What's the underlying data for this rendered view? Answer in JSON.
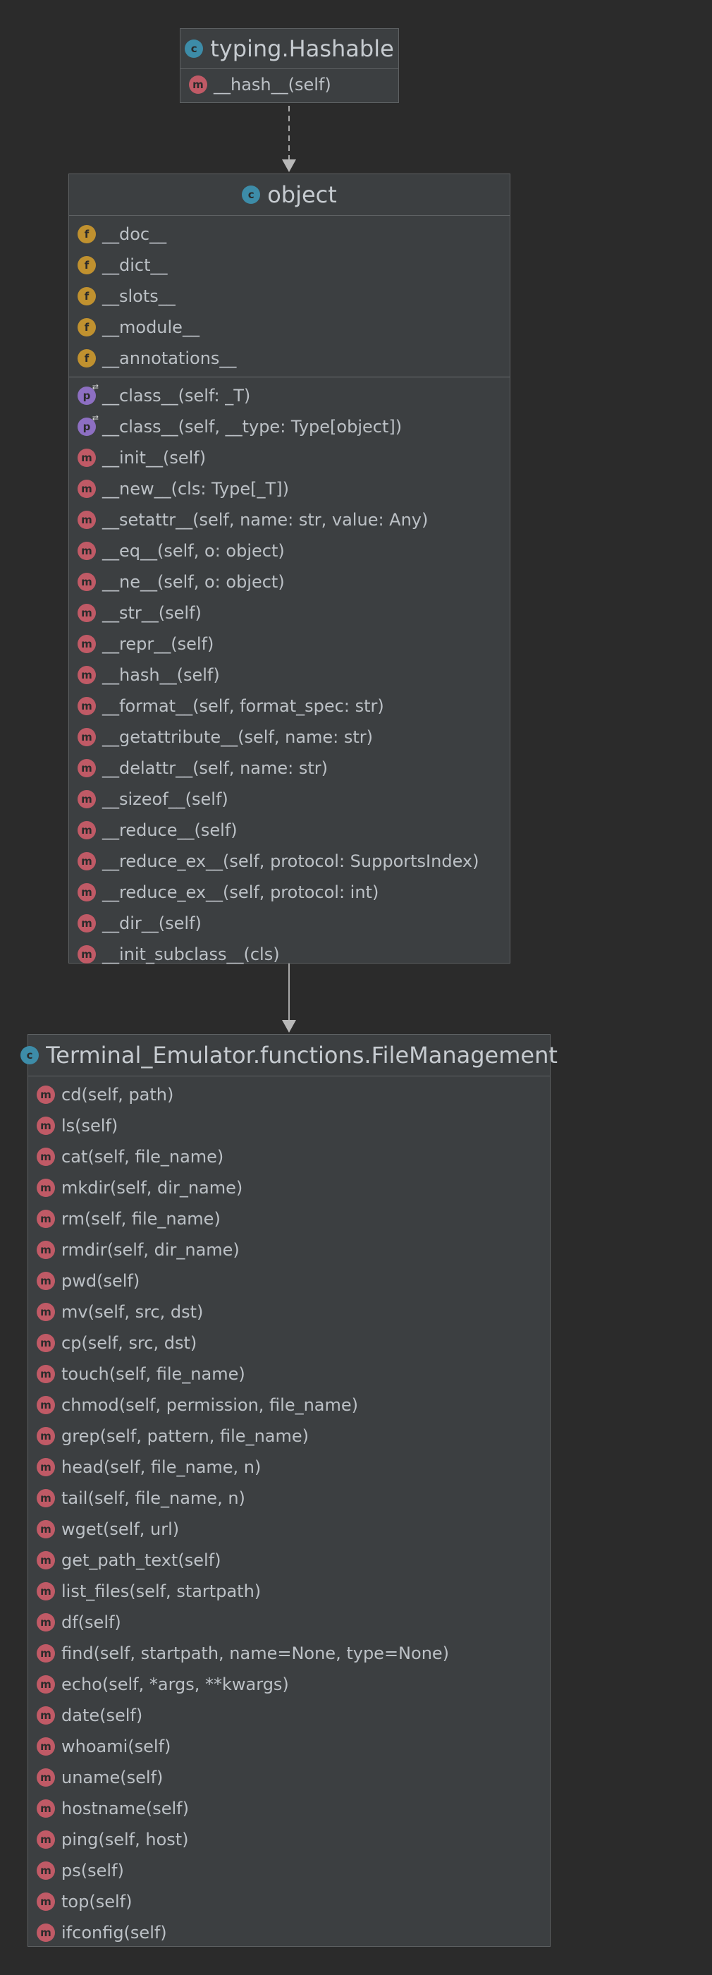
{
  "hashable": {
    "title": "typing.Hashable",
    "icon": "class-icon",
    "methods": [
      {
        "kind": "method",
        "glyph": "m",
        "text": "__hash__(self)"
      }
    ]
  },
  "object": {
    "title": "object",
    "icon": "class-icon",
    "fields": [
      {
        "kind": "field",
        "glyph": "f",
        "text": "__doc__"
      },
      {
        "kind": "field",
        "glyph": "f",
        "text": "__dict__"
      },
      {
        "kind": "field",
        "glyph": "f",
        "text": "__slots__"
      },
      {
        "kind": "field",
        "glyph": "f",
        "text": "__module__"
      },
      {
        "kind": "field",
        "glyph": "f",
        "text": "__annotations__"
      }
    ],
    "methods": [
      {
        "kind": "property",
        "glyph": "p",
        "text": "__class__(self: _T)"
      },
      {
        "kind": "property",
        "glyph": "p",
        "text": "__class__(self, __type: Type[object])"
      },
      {
        "kind": "method",
        "glyph": "m",
        "text": "__init__(self)"
      },
      {
        "kind": "method",
        "glyph": "m",
        "text": "__new__(cls: Type[_T])"
      },
      {
        "kind": "method",
        "glyph": "m",
        "text": "__setattr__(self, name: str, value: Any)"
      },
      {
        "kind": "method",
        "glyph": "m",
        "text": "__eq__(self, o: object)"
      },
      {
        "kind": "method",
        "glyph": "m",
        "text": "__ne__(self, o: object)"
      },
      {
        "kind": "method",
        "glyph": "m",
        "text": "__str__(self)"
      },
      {
        "kind": "method",
        "glyph": "m",
        "text": "__repr__(self)"
      },
      {
        "kind": "method",
        "glyph": "m",
        "text": "__hash__(self)"
      },
      {
        "kind": "method",
        "glyph": "m",
        "text": "__format__(self, format_spec: str)"
      },
      {
        "kind": "method",
        "glyph": "m",
        "text": "__getattribute__(self, name: str)"
      },
      {
        "kind": "method",
        "glyph": "m",
        "text": "__delattr__(self, name: str)"
      },
      {
        "kind": "method",
        "glyph": "m",
        "text": "__sizeof__(self)"
      },
      {
        "kind": "method",
        "glyph": "m",
        "text": "__reduce__(self)"
      },
      {
        "kind": "method",
        "glyph": "m",
        "text": "__reduce_ex__(self, protocol: SupportsIndex)"
      },
      {
        "kind": "method",
        "glyph": "m",
        "text": "__reduce_ex__(self, protocol: int)"
      },
      {
        "kind": "method",
        "glyph": "m",
        "text": "__dir__(self)"
      },
      {
        "kind": "method",
        "glyph": "m",
        "text": "__init_subclass__(cls)"
      }
    ]
  },
  "filemanagement": {
    "title": "Terminal_Emulator.functions.FileManagement",
    "icon": "class-icon",
    "methods": [
      {
        "kind": "method",
        "glyph": "m",
        "text": "cd(self, path)"
      },
      {
        "kind": "method",
        "glyph": "m",
        "text": "ls(self)"
      },
      {
        "kind": "method",
        "glyph": "m",
        "text": "cat(self, file_name)"
      },
      {
        "kind": "method",
        "glyph": "m",
        "text": "mkdir(self, dir_name)"
      },
      {
        "kind": "method",
        "glyph": "m",
        "text": "rm(self, file_name)"
      },
      {
        "kind": "method",
        "glyph": "m",
        "text": "rmdir(self, dir_name)"
      },
      {
        "kind": "method",
        "glyph": "m",
        "text": "pwd(self)"
      },
      {
        "kind": "method",
        "glyph": "m",
        "text": "mv(self, src, dst)"
      },
      {
        "kind": "method",
        "glyph": "m",
        "text": "cp(self, src, dst)"
      },
      {
        "kind": "method",
        "glyph": "m",
        "text": "touch(self, file_name)"
      },
      {
        "kind": "method",
        "glyph": "m",
        "text": "chmod(self, permission, file_name)"
      },
      {
        "kind": "method",
        "glyph": "m",
        "text": "grep(self, pattern, file_name)"
      },
      {
        "kind": "method",
        "glyph": "m",
        "text": "head(self, file_name, n)"
      },
      {
        "kind": "method",
        "glyph": "m",
        "text": "tail(self, file_name, n)"
      },
      {
        "kind": "method",
        "glyph": "m",
        "text": "wget(self, url)"
      },
      {
        "kind": "method",
        "glyph": "m",
        "text": "get_path_text(self)"
      },
      {
        "kind": "method",
        "glyph": "m",
        "text": "list_files(self, startpath)"
      },
      {
        "kind": "method",
        "glyph": "m",
        "text": "df(self)"
      },
      {
        "kind": "method",
        "glyph": "m",
        "text": "find(self, startpath, name=None, type=None)"
      },
      {
        "kind": "method",
        "glyph": "m",
        "text": "echo(self, *args, **kwargs)"
      },
      {
        "kind": "method",
        "glyph": "m",
        "text": "date(self)"
      },
      {
        "kind": "method",
        "glyph": "m",
        "text": "whoami(self)"
      },
      {
        "kind": "method",
        "glyph": "m",
        "text": "uname(self)"
      },
      {
        "kind": "method",
        "glyph": "m",
        "text": "hostname(self)"
      },
      {
        "kind": "method",
        "glyph": "m",
        "text": "ping(self, host)"
      },
      {
        "kind": "method",
        "glyph": "m",
        "text": "ps(self)"
      },
      {
        "kind": "method",
        "glyph": "m",
        "text": "top(self)"
      },
      {
        "kind": "method",
        "glyph": "m",
        "text": "ifconfig(self)"
      }
    ]
  },
  "colors": {
    "background": "#2b2b2b",
    "box": "#3c3f41",
    "border": "#5e6163",
    "text": "#bcc1c6",
    "method_icon": "#c05a66",
    "field_icon": "#c0912f",
    "property_icon": "#8d6fc2",
    "class_icon": "#3d8ca8",
    "edge": "#a9a9a9"
  },
  "relations": [
    {
      "from": "object",
      "to": "typing.Hashable",
      "type": "implements"
    },
    {
      "from": "Terminal_Emulator.functions.FileManagement",
      "to": "object",
      "type": "extends"
    }
  ]
}
